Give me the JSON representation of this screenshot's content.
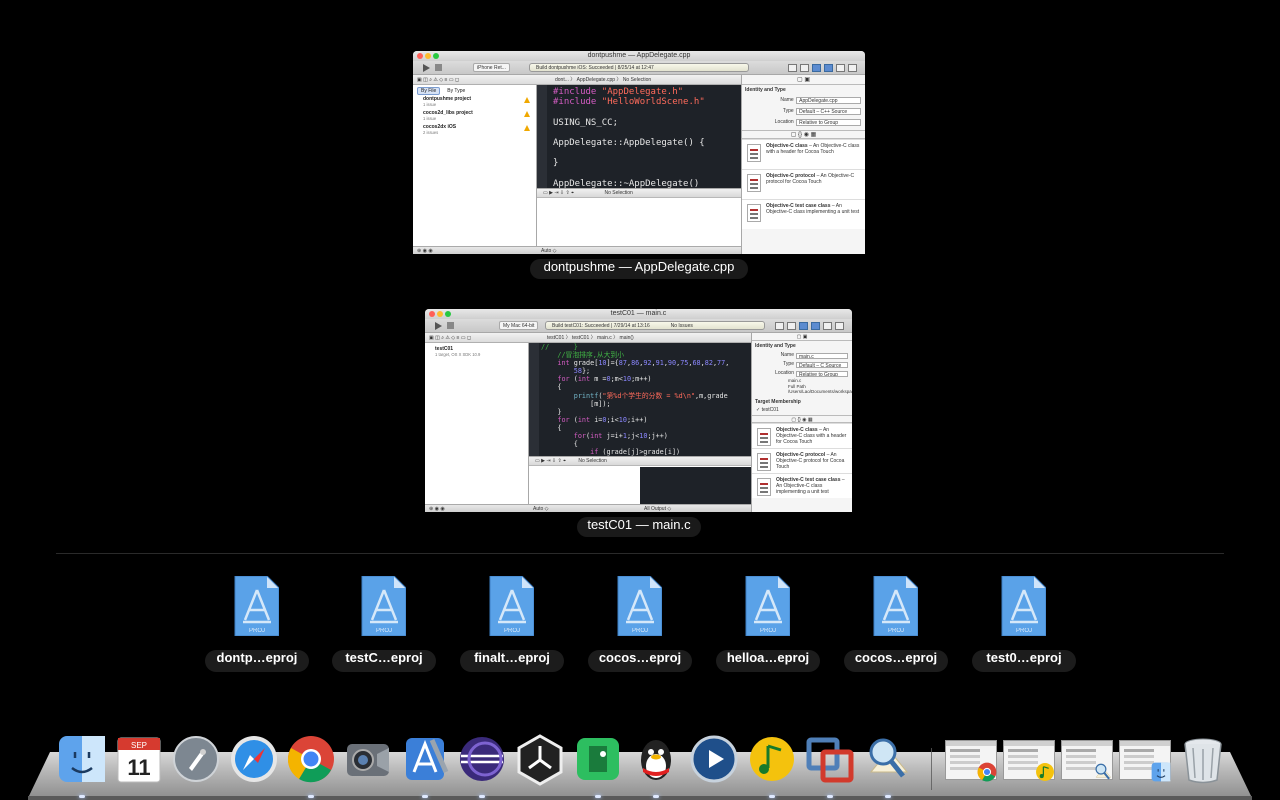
{
  "windows": [
    {
      "title": "dontpushme — AppDelegate.cpp",
      "label": "dontpushme — AppDelegate.cpp",
      "toolbar": {
        "scheme": "iPhone Ret...",
        "status": "Build dontpushme iOS: Succeeded",
        "status_time": "8/25/14 at 12:47"
      },
      "jumpbar": {
        "path": "dont... 〉 AppDelegate.cpp 〉 No Selection"
      },
      "navigator": {
        "tabs": [
          "By File",
          "By Type"
        ],
        "items": [
          {
            "name": "dontpushme project",
            "detail": "1 issue"
          },
          {
            "name": "cocos2d_libs project",
            "detail": "1 issue"
          },
          {
            "name": "cocos2dx iOS",
            "detail": "2 issues"
          }
        ]
      },
      "code": [
        {
          "text": "#include \"AppDelegate.h\"",
          "kw": "#include",
          "str": "\"AppDelegate.h\""
        },
        {
          "text": "#include \"HelloWorldScene.h\"",
          "kw": "#include",
          "str": "\"HelloWorldScene.h\""
        },
        {
          "text": ""
        },
        {
          "text": "USING_NS_CC;"
        },
        {
          "text": ""
        },
        {
          "text": "AppDelegate::AppDelegate() {"
        },
        {
          "text": ""
        },
        {
          "text": "}"
        },
        {
          "text": ""
        },
        {
          "text": "AppDelegate::~AppDelegate()"
        }
      ],
      "debug": {
        "selection": "No Selection",
        "bottom_left": "Auto ◇"
      },
      "inspector": {
        "heading": "Identity and Type",
        "rows": [
          {
            "key": "Name",
            "value": "AppDelegate.cpp"
          },
          {
            "key": "Type",
            "value": "Default – C++ Source"
          },
          {
            "key": "Location",
            "value": "Relative to Group"
          }
        ],
        "library": [
          {
            "title": "Objective-C class",
            "desc": " – An Objective-C class with a header for Cocoa Touch"
          },
          {
            "title": "Objective-C protocol",
            "desc": " – An Objective-C protocol for Cocoa Touch"
          },
          {
            "title": "Objective-C test case class",
            "desc": " – An Objective-C class implementing a unit test"
          }
        ]
      }
    },
    {
      "title": "testC01 — main.c",
      "label": "testC01 — main.c",
      "toolbar": {
        "scheme": "My Mac 64-bit",
        "status": "Build testC01: Succeeded",
        "status_time": "7/29/14 at 13:16",
        "issues": "No Issues"
      },
      "jumpbar": {
        "path": "testC01 〉 testC01 〉 main.c 〉 main()"
      },
      "navigator": {
        "items": [
          {
            "name": "testC01",
            "detail": "1 target, OS X SDK 10.9"
          }
        ]
      },
      "code": [
        {
          "text": "//      }"
        },
        {
          "text": "    //冒泡排序,从大到小"
        },
        {
          "text": "    int grade[10]={87,86,92,91,90,75,68,82,77,"
        },
        {
          "text": "        58};"
        },
        {
          "text": "    for (int m =0;m<10;m++)"
        },
        {
          "text": "    {"
        },
        {
          "text": "        printf(\"第%d个学生的分数 = %d\\n\",m,grade"
        },
        {
          "text": "            [m]);"
        },
        {
          "text": "    }"
        },
        {
          "text": "    for (int i=0;i<10;i++)"
        },
        {
          "text": "    {"
        },
        {
          "text": "        for(int j=i+1;j<10;j++)"
        },
        {
          "text": "        {"
        },
        {
          "text": "            if (grade[j]>grade[i])"
        }
      ],
      "debug": {
        "selection": "No Selection",
        "bottom_left": "Auto ◇",
        "bottom_right": "All Output ◇"
      },
      "inspector": {
        "heading": "Identity and Type",
        "rows": [
          {
            "key": "Name",
            "value": "main.c"
          },
          {
            "key": "Type",
            "value": "Default – C Source"
          },
          {
            "key": "Location",
            "value": "Relative to Group"
          }
        ],
        "extra": [
          "main.c",
          "Full Path /Users/Lao/Documents/workspace/C/testC01/testC01/main.c"
        ],
        "membership_heading": "Target Membership",
        "membership_item": "testC01",
        "library": [
          {
            "title": "Objective-C class",
            "desc": " – An Objective-C class with a header for Cocoa Touch"
          },
          {
            "title": "Objective-C protocol",
            "desc": " – An Objective-C protocol for Cocoa Touch"
          },
          {
            "title": "Objective-C test case class",
            "desc": " – An Objective-C class implementing a unit test"
          }
        ]
      }
    }
  ],
  "project_files": [
    {
      "label": "dontp…eproj",
      "icon": "xcodeproj-icon"
    },
    {
      "label": "testC…eproj",
      "icon": "xcodeproj-icon"
    },
    {
      "label": "finalt…eproj",
      "icon": "xcodeproj-icon"
    },
    {
      "label": "cocos…eproj",
      "icon": "xcodeproj-icon"
    },
    {
      "label": "helloa…eproj",
      "icon": "xcodeproj-icon"
    },
    {
      "label": "cocos…eproj",
      "icon": "xcodeproj-icon"
    },
    {
      "label": "test0…eproj",
      "icon": "xcodeproj-icon"
    }
  ],
  "proj_icon_text": "PROJ",
  "dock": {
    "apps": [
      {
        "name": "finder",
        "icon": "finder-icon",
        "running": true
      },
      {
        "name": "calendar",
        "icon": "calendar-icon",
        "running": false,
        "month": "SEP",
        "day": "11"
      },
      {
        "name": "launchpad",
        "icon": "launchpad-icon",
        "running": false
      },
      {
        "name": "safari",
        "icon": "safari-icon",
        "running": false
      },
      {
        "name": "chrome",
        "icon": "chrome-icon",
        "running": true
      },
      {
        "name": "facetime",
        "icon": "facetime-icon",
        "running": false
      },
      {
        "name": "xcode",
        "icon": "xcode-icon",
        "running": true
      },
      {
        "name": "eclipse",
        "icon": "eclipse-icon",
        "running": true
      },
      {
        "name": "unity",
        "icon": "unity-icon",
        "running": false
      },
      {
        "name": "evernote",
        "icon": "evernote-icon",
        "running": true
      },
      {
        "name": "qq",
        "icon": "qq-icon",
        "running": true
      },
      {
        "name": "quicktime",
        "icon": "quicktime-icon",
        "running": false
      },
      {
        "name": "music",
        "icon": "music-icon",
        "running": true
      },
      {
        "name": "vmware",
        "icon": "vmware-icon",
        "running": true
      },
      {
        "name": "preview",
        "icon": "preview-icon",
        "running": true
      }
    ],
    "minimized": [
      {
        "name": "minimized-chrome-window",
        "icon": "chrome-icon"
      },
      {
        "name": "minimized-photo-window",
        "icon": "music-icon"
      },
      {
        "name": "minimized-preview-window",
        "icon": "preview-icon"
      },
      {
        "name": "minimized-finder-window",
        "icon": "finder-icon"
      }
    ],
    "trash": {
      "icon": "trash-icon"
    }
  },
  "colors": {
    "background": "#000000",
    "code_keyword": "#d35cc2",
    "code_string": "#ff6b5b",
    "code_comment": "#41b645",
    "code_number": "#8b87ff",
    "xcode_blue": "#5aa2e8"
  }
}
